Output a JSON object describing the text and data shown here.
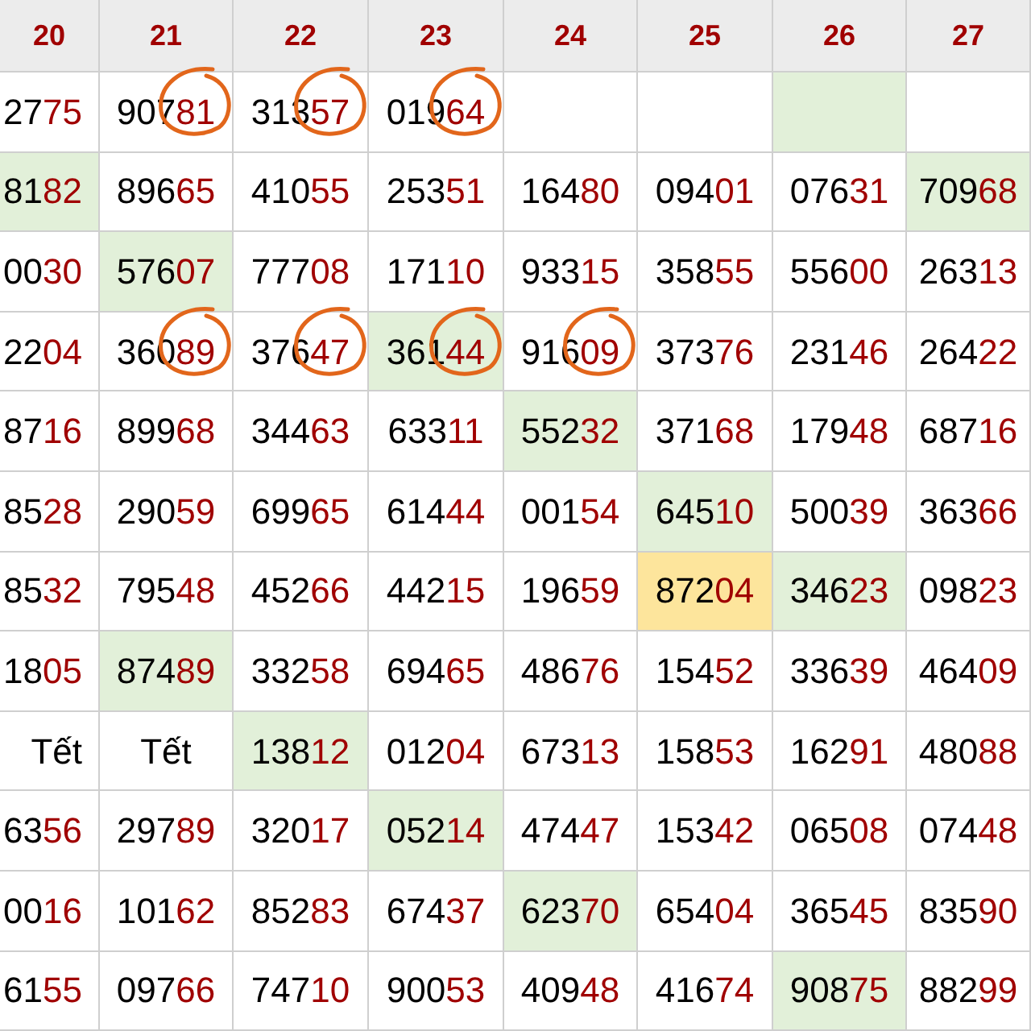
{
  "columns": [
    "20",
    "21",
    "22",
    "23",
    "24",
    "25",
    "26",
    "27"
  ],
  "rows": [
    [
      {
        "text": "2775"
      },
      {
        "text": "90781",
        "circled": true
      },
      {
        "text": "31357",
        "circled": true
      },
      {
        "text": "01964",
        "circled": true
      },
      {
        "text": ""
      },
      {
        "text": ""
      },
      {
        "text": "",
        "color": "#e2f0d9"
      },
      {
        "text": ""
      }
    ],
    [
      {
        "text": "8182",
        "color": "#e2f0d9"
      },
      {
        "text": "89665"
      },
      {
        "text": "41055"
      },
      {
        "text": "25351"
      },
      {
        "text": "16480"
      },
      {
        "text": "09401"
      },
      {
        "text": "07631"
      },
      {
        "text": "70968",
        "color": "#e2f0d9"
      }
    ],
    [
      {
        "text": "0030"
      },
      {
        "text": "57607",
        "color": "#e2f0d9"
      },
      {
        "text": "77708"
      },
      {
        "text": "17110"
      },
      {
        "text": "93315"
      },
      {
        "text": "35855"
      },
      {
        "text": "55600"
      },
      {
        "text": "26313"
      }
    ],
    [
      {
        "text": "2204"
      },
      {
        "text": "36089",
        "circled": true
      },
      {
        "text": "37647",
        "circled": true
      },
      {
        "text": "36144",
        "color": "#e2f0d9",
        "circled": true
      },
      {
        "text": "91609",
        "circled": true
      },
      {
        "text": "37376"
      },
      {
        "text": "23146"
      },
      {
        "text": "26422"
      }
    ],
    [
      {
        "text": "8716"
      },
      {
        "text": "89968"
      },
      {
        "text": "34463"
      },
      {
        "text": "63311"
      },
      {
        "text": "55232",
        "color": "#e2f0d9"
      },
      {
        "text": "37168"
      },
      {
        "text": "17948"
      },
      {
        "text": "68716"
      }
    ],
    [
      {
        "text": "8528"
      },
      {
        "text": "29059"
      },
      {
        "text": "69965"
      },
      {
        "text": "61444"
      },
      {
        "text": "00154"
      },
      {
        "text": "64510",
        "color": "#e2f0d9"
      },
      {
        "text": "50039"
      },
      {
        "text": "36366"
      }
    ],
    [
      {
        "text": "8532"
      },
      {
        "text": "79548"
      },
      {
        "text": "45266"
      },
      {
        "text": "44215"
      },
      {
        "text": "19659"
      },
      {
        "text": "87204",
        "color": "#fde59c"
      },
      {
        "text": "34623",
        "color": "#e2f0d9"
      },
      {
        "text": "09823"
      }
    ],
    [
      {
        "text": "1805"
      },
      {
        "text": "87489",
        "color": "#e2f0d9"
      },
      {
        "text": "33258"
      },
      {
        "text": "69465"
      },
      {
        "text": "48676"
      },
      {
        "text": "15452"
      },
      {
        "text": "33639"
      },
      {
        "text": "46409"
      }
    ],
    [
      {
        "text": "Tết",
        "kind": "word"
      },
      {
        "text": "Tết",
        "kind": "word"
      },
      {
        "text": "13812",
        "color": "#e2f0d9"
      },
      {
        "text": "01204"
      },
      {
        "text": "67313"
      },
      {
        "text": "15853"
      },
      {
        "text": "16291"
      },
      {
        "text": "48088"
      }
    ],
    [
      {
        "text": "6356"
      },
      {
        "text": "29789"
      },
      {
        "text": "32017"
      },
      {
        "text": "05214",
        "color": "#e2f0d9"
      },
      {
        "text": "47447"
      },
      {
        "text": "15342"
      },
      {
        "text": "06508"
      },
      {
        "text": "07448"
      }
    ],
    [
      {
        "text": "0016"
      },
      {
        "text": "10162"
      },
      {
        "text": "85283"
      },
      {
        "text": "67437"
      },
      {
        "text": "62370",
        "color": "#e2f0d9"
      },
      {
        "text": "65404"
      },
      {
        "text": "36545"
      },
      {
        "text": "83590"
      }
    ],
    [
      {
        "text": "6155"
      },
      {
        "text": "09766"
      },
      {
        "text": "74710"
      },
      {
        "text": "90053"
      },
      {
        "text": "40948"
      },
      {
        "text": "41674"
      },
      {
        "text": "90875",
        "color": "#e2f0d9"
      },
      {
        "text": "88299"
      }
    ]
  ]
}
